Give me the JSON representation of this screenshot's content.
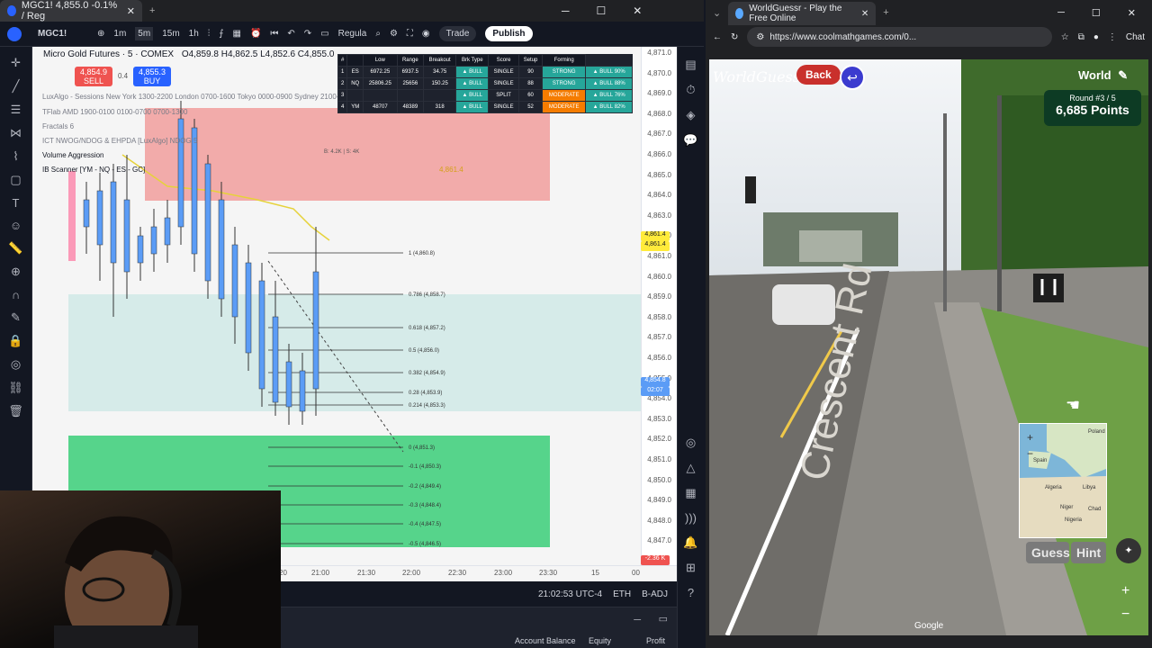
{
  "tv_window": {
    "tab_title": "MGC1! 4,855.0 -0.1% / Reg",
    "toolbar": {
      "symbol": "MGC1!",
      "tf_1m": "1m",
      "tf_5m": "5m",
      "tf_15m": "15m",
      "tf_1h": "1h",
      "session": "Regula",
      "trade": "Trade",
      "publish": "Publish"
    },
    "legend": {
      "title": "Micro Gold Futures · 5 · COMEX",
      "ohlc": "O4,859.8 H4,862.5 L4,852.6 C4,855.0",
      "sell_price": "4,854.9",
      "sell_label": "SELL",
      "spread": "0.4",
      "buy_price": "4,855.3",
      "buy_label": "BUY"
    },
    "indicators": [
      "LuxAlgo - Sessions New York 1300-2200 London 0700-1600 Tokyo 0000-0900 Sydney 2100-0600",
      "TFlab AMD 1900-0100 0100-0700 0700-1300",
      "Fractals 6",
      "ICT NWOG/NDOG & EHPDA [LuxAlgo] NDOG 5",
      "Volume Aggression",
      "IB Scanner [YM - NQ - ES - GC]"
    ],
    "scanner": {
      "headers": [
        "#",
        "",
        "Low",
        "Range",
        "Breakout",
        "Brk Type",
        "Score",
        "Setup",
        "Forming"
      ],
      "rows": [
        [
          "1",
          "ES",
          "6972.25",
          "6937.5",
          "34.75",
          "▲ BULL",
          "SINGLE",
          "90",
          "STRONG",
          "▲ BULL 90%"
        ],
        [
          "2",
          "NQ",
          "25806.25",
          "25656",
          "150.25",
          "▲ BULL",
          "SINGLE",
          "88",
          "STRONG",
          "▲ BULL 88%"
        ],
        [
          "3",
          "",
          "",
          "",
          "",
          "▲ BULL",
          "SPLIT",
          "60",
          "MODERATE",
          "▲ BULL 76%"
        ],
        [
          "4",
          "YM",
          "48707",
          "48389",
          "318",
          "▲ BULL",
          "SINGLE",
          "52",
          "MODERATE",
          "▲ BULL 82%"
        ]
      ]
    },
    "vol_label": "B: 4.2K | S: 4K",
    "ib_line": "4,861.4",
    "fib_levels": [
      "1 (4,860.8)",
      "0.786 (4,858.7)",
      "0.618 (4,857.2)",
      "0.5 (4,856.0)",
      "0.382 (4,854.9)",
      "0.28 (4,853.9)",
      "0.214 (4,853.3)",
      "0 (4,851.3)",
      "-0.1 (4,850.3)",
      "-0.2 (4,849.4)",
      "-0.3 (4,848.4)",
      "-0.4 (4,847.5)",
      "-0.5 (4,846.5)"
    ],
    "price_axis": [
      "4,871.0",
      "4,870.0",
      "4,869.0",
      "4,868.0",
      "4,867.0",
      "4,866.0",
      "4,865.0",
      "4,864.0",
      "4,863.0",
      "4,862.0",
      "4,861.0",
      "4,860.0",
      "4,859.0",
      "4,858.0",
      "4,857.0",
      "4,856.0",
      "4,855.0",
      "4,854.0",
      "4,853.0",
      "4,852.0",
      "4,851.0",
      "4,850.0",
      "4,849.0",
      "4,848.0",
      "4,847.0"
    ],
    "price_tags": {
      "ib_a": "4,861.4",
      "ib_b": "4,861.4",
      "last": "4,854.8",
      "countdown": "02:07",
      "pnl": "-2.36 K"
    },
    "time_axis": [
      "20",
      "21:00",
      "21:30",
      "22:00",
      "22:30",
      "23:00",
      "23:30",
      "15",
      "00"
    ],
    "status": {
      "clock": "21:02:53 UTC-4",
      "eth": "ETH",
      "badj": "B-ADJ"
    },
    "account": {
      "balance": "Account Balance",
      "equity": "Equity",
      "profit": "Profit"
    }
  },
  "gw_window": {
    "tab_title": "WorldGuessr - Play the Free Online",
    "url": "https://www.coolmathgames.com/0...",
    "logo": "WorldGuessr",
    "back": "Back",
    "mode": "World",
    "round": "Round #3 / 5",
    "points": "6,685 Points",
    "road_text": "Crescent Rd",
    "guess": "Guess",
    "hint": "Hint",
    "google": "Google",
    "chat": "Chat",
    "map_labels": [
      "Poland",
      "Spain",
      "Libya",
      "Algeria",
      "Niger",
      "Chad",
      "Nigeria"
    ]
  }
}
